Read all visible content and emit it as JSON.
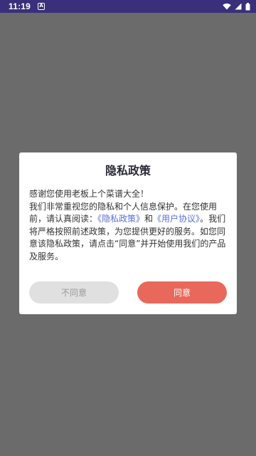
{
  "status_bar": {
    "time": "11:19",
    "notification_glyph": "A",
    "icons": [
      "wifi-icon",
      "cellular-signal-icon",
      "battery-icon"
    ]
  },
  "dialog": {
    "title": "隐私政策",
    "body": {
      "line1": "感谢您使用老板上个菜谱大全！",
      "intro": "我们非常重视您的隐私和个人信息保护。在您使用前，请认真阅读：",
      "link_privacy": "《隐私政策》",
      "connector": "和",
      "link_agreement": "《用户协议》",
      "outro": "。我们将严格按照前述政策，为您提供更好的服务。如您同意该隐私政策，请点击“同意”并开始使用我们的产品及服务。"
    },
    "buttons": {
      "disagree": "不同意",
      "agree": "同意"
    }
  },
  "colors": {
    "status_bar": "#3a2f7a",
    "overlay": "#6b6b6b",
    "link": "#5a6fd8",
    "agree_button": "#e8695c",
    "disagree_button": "#e0e0e0"
  }
}
